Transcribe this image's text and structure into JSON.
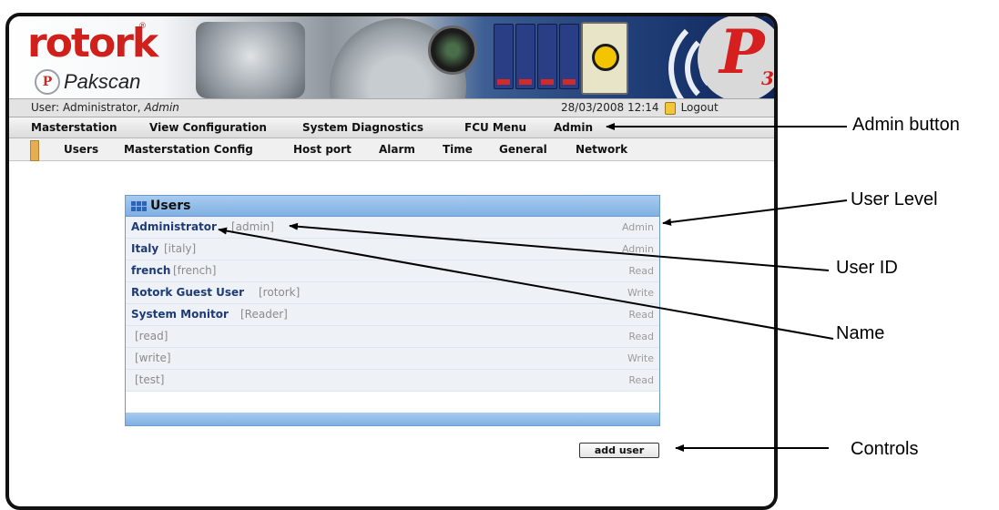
{
  "brand": {
    "logo": "rotork",
    "product": "Pakscan",
    "product_mark": "P",
    "badge_letter": "P",
    "badge_number": "3"
  },
  "userbar": {
    "user_prefix": "User: Administrator, ",
    "user_role": "Admin",
    "datetime": "28/03/2008 12:14",
    "logout": "Logout"
  },
  "main_menu": [
    "Masterstation",
    "View Configuration",
    "System Diagnostics",
    "FCU Menu",
    "Admin"
  ],
  "sub_menu": [
    "Users",
    "Masterstation Config",
    "Host port",
    "Alarm",
    "Time",
    "General",
    "Network"
  ],
  "panel": {
    "title": "Users"
  },
  "users": [
    {
      "name": "Administrator",
      "id": "[admin]",
      "level": "Admin"
    },
    {
      "name": "Italy",
      "id": "[italy]",
      "level": "Admin"
    },
    {
      "name": "french",
      "id": "[french]",
      "level": "Read"
    },
    {
      "name": "Rotork Guest User",
      "id": "[rotork]",
      "level": "Write"
    },
    {
      "name": "System Monitor",
      "id": "[Reader]",
      "level": "Read"
    },
    {
      "name": "",
      "id": "[read]",
      "level": "Read"
    },
    {
      "name": "",
      "id": "[write]",
      "level": "Write"
    },
    {
      "name": "",
      "id": "[test]",
      "level": "Read"
    }
  ],
  "controls": {
    "add_user": "add user"
  },
  "annotations": {
    "admin_button": "Admin button",
    "user_level": "User Level",
    "user_id": "User ID",
    "name": "Name",
    "controls": "Controls"
  },
  "colors": {
    "brand_red": "#d0201b",
    "panel_blue": "#7fb0e3",
    "name_blue": "#1e3b78",
    "submenu_marker": "#e6ad52"
  }
}
